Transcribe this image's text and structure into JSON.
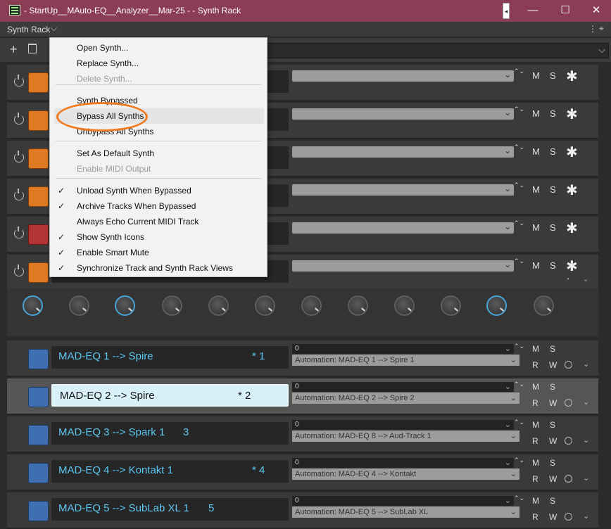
{
  "window": {
    "title": "- StartUp__MAuto-EQ__Analyzer__Mar-25 - - Synth Rack",
    "snap_glyph": "◂",
    "min_glyph": "—",
    "max_glyph": "☐",
    "close_glyph": "✕"
  },
  "toolbar": {
    "label": "Synth Rack",
    "caret": "⌵",
    "dots": "⋮",
    "pin": "⌖",
    "add": "+",
    "combo_caret": "⌵"
  },
  "synths": [
    {
      "color": "orange"
    },
    {
      "color": "orange"
    },
    {
      "color": "orange"
    },
    {
      "color": "orange"
    },
    {
      "color": "red"
    },
    {
      "color": "orange"
    }
  ],
  "synth_controls": {
    "m": "M",
    "s": "S",
    "star": "✱",
    "spin": "⌃⌄"
  },
  "tracks": [
    {
      "name": "MAD-EQ 1 --> Spire",
      "num": "* 1",
      "value": "0",
      "automation": "Automation: MAD-EQ 1 --> Spire 1",
      "selected": false
    },
    {
      "name": "MAD-EQ 2 --> Spire",
      "num": "* 2",
      "value": "0",
      "automation": "Automation: MAD-EQ 2 --> Spire 2",
      "selected": true
    },
    {
      "name": "MAD-EQ 3 --> Spark 1",
      "num": "3",
      "value": "0",
      "automation": "Automation: MAD-EQ 8 --> Aud-Track 1",
      "selected": false
    },
    {
      "name": "MAD-EQ 4 --> Kontakt 1",
      "num": "* 4",
      "value": "0",
      "automation": "Automation: MAD-EQ 4 --> Kontakt",
      "selected": false
    },
    {
      "name": "MAD-EQ 5 --> SubLab XL 1",
      "num": "5",
      "value": "0",
      "automation": "Automation: MAD-EQ 5 --> SubLab XL",
      "selected": false
    }
  ],
  "track_controls": {
    "m": "M",
    "s": "S",
    "r": "R",
    "w": "W",
    "chev": "⌄"
  },
  "menu": {
    "items": [
      {
        "label": "Open Synth...",
        "disabled": false,
        "checked": false
      },
      {
        "label": "Replace Synth...",
        "disabled": false,
        "checked": false
      },
      {
        "label": "Delete Synth...",
        "disabled": true,
        "checked": false
      },
      {
        "label": "Synth Bypassed",
        "disabled": false,
        "checked": false
      },
      {
        "label": "Bypass All Synths",
        "disabled": false,
        "checked": false
      },
      {
        "label": "Unbypass All Synths",
        "disabled": false,
        "checked": false
      },
      {
        "label": "Set As Default Synth",
        "disabled": false,
        "checked": false
      },
      {
        "label": "Enable MIDI Output",
        "disabled": true,
        "checked": false
      },
      {
        "label": "Unload Synth When Bypassed",
        "disabled": false,
        "checked": true
      },
      {
        "label": "Archive Tracks When Bypassed",
        "disabled": false,
        "checked": true
      },
      {
        "label": "Always Echo Current MIDI Track",
        "disabled": false,
        "checked": false
      },
      {
        "label": "Show Synth Icons",
        "disabled": false,
        "checked": true
      },
      {
        "label": "Enable Smart Mute",
        "disabled": false,
        "checked": true
      },
      {
        "label": "Synchronize Track and Synth Rack Views",
        "disabled": false,
        "checked": true
      }
    ],
    "check_glyph": "✓"
  },
  "colors": {
    "titlebar": "#8c3d56",
    "accent_blue": "#5cc7f0",
    "highlight": "#f07a1f"
  }
}
